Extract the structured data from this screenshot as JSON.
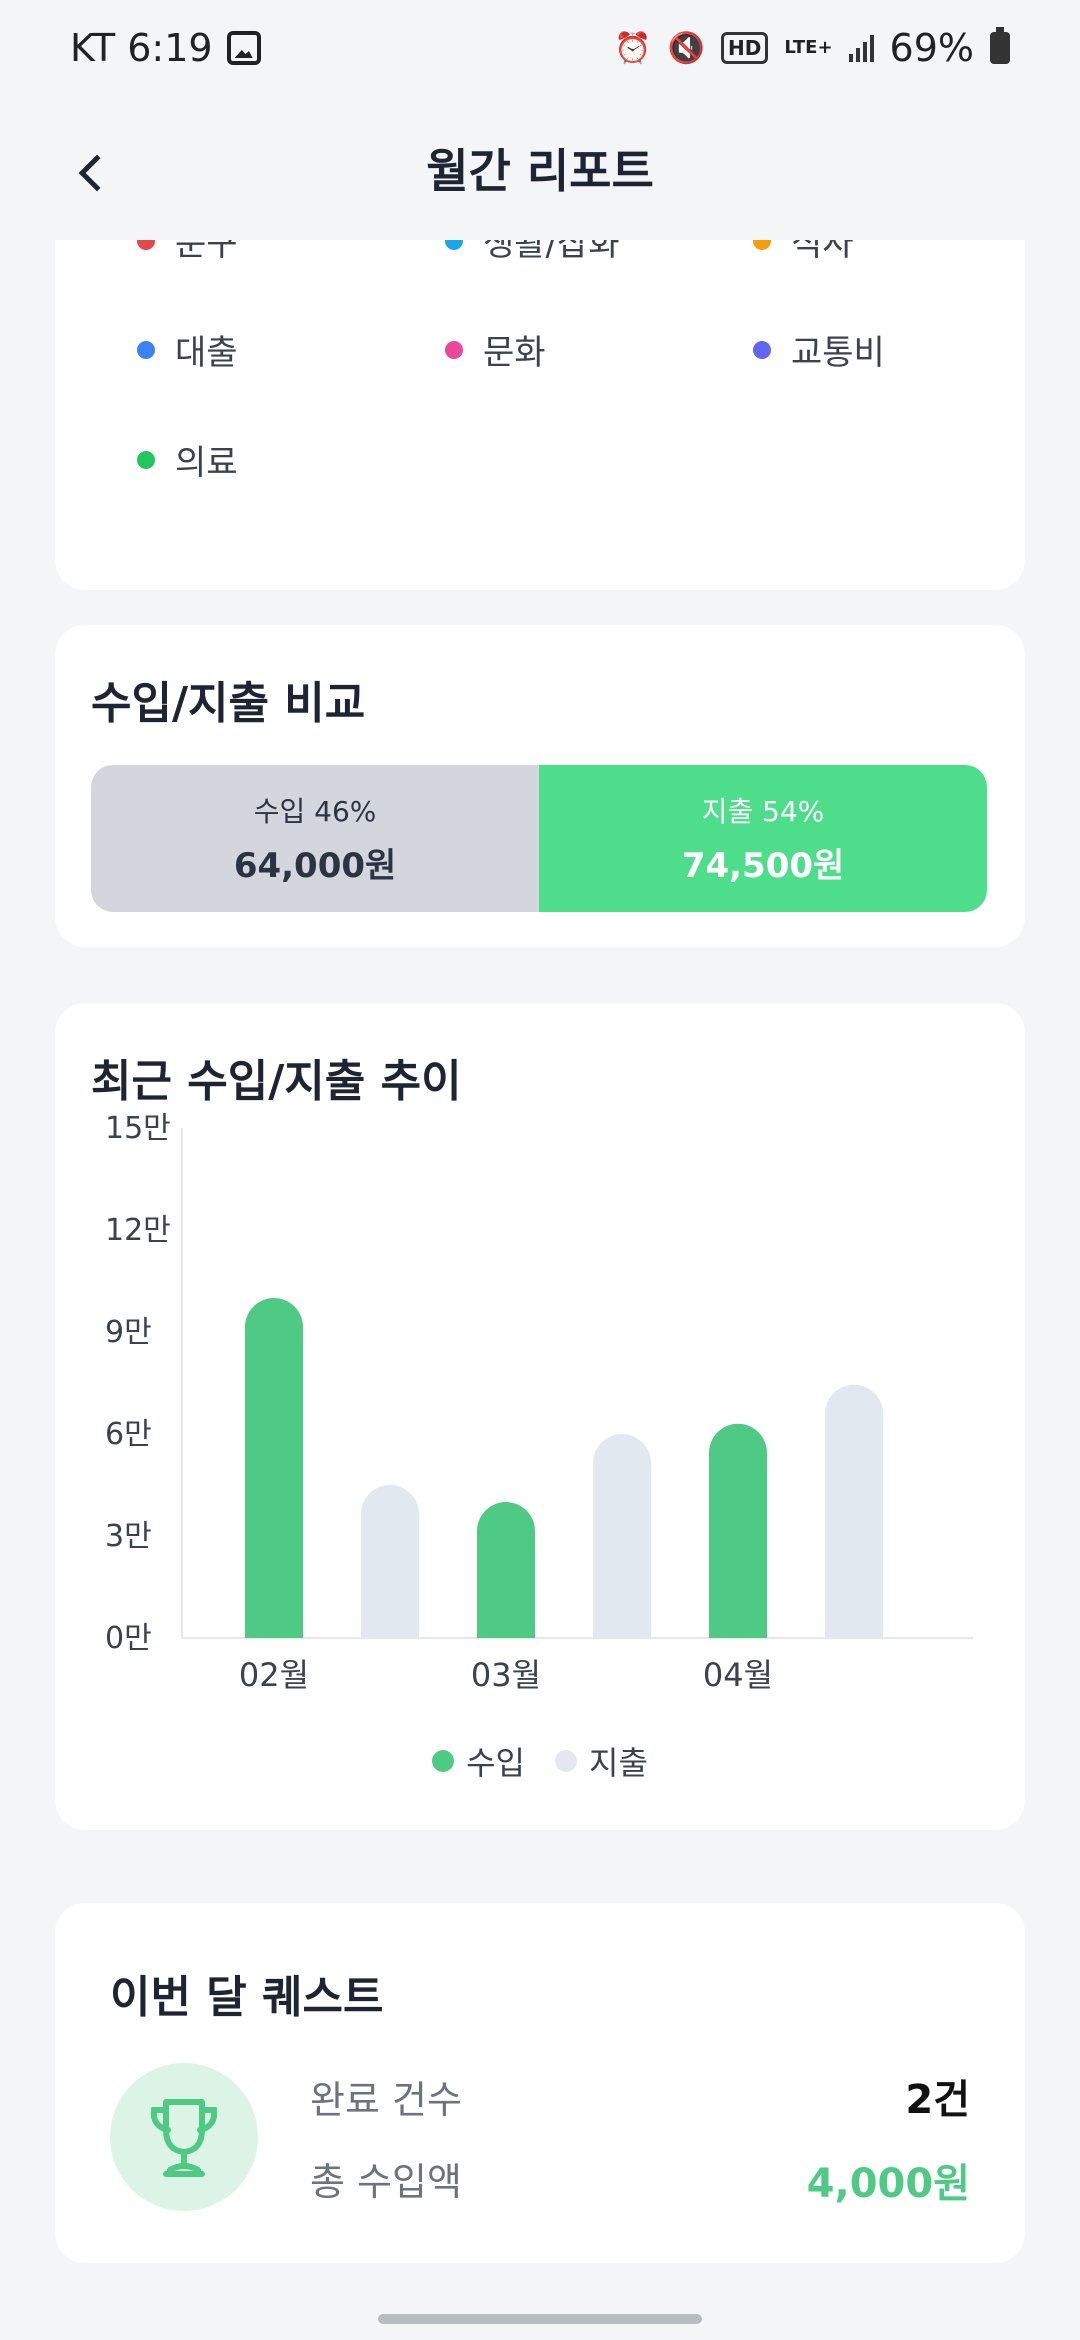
{
  "status_bar": {
    "carrier_time": "KT 6:19",
    "battery": "69%",
    "hd": "HD",
    "lte": "LTE+"
  },
  "header": {
    "title": "월간 리포트"
  },
  "category_legend": {
    "items": [
      {
        "label": "문구",
        "color": "#e54848"
      },
      {
        "label": "생활/잡화",
        "color": "#1aa7e8"
      },
      {
        "label": "식사",
        "color": "#f59e0b"
      },
      {
        "label": "대출",
        "color": "#3b82f6"
      },
      {
        "label": "문화",
        "color": "#ec4899"
      },
      {
        "label": "교통비",
        "color": "#6366f1"
      },
      {
        "label": "의료",
        "color": "#22c55e"
      }
    ]
  },
  "compare": {
    "title": "수입/지출 비교",
    "income_label": "수입 46%",
    "income_amount": "64,000원",
    "expense_label": "지출 54%",
    "expense_amount": "74,500원",
    "income_share": 0.46
  },
  "trend": {
    "title": "최근 수입/지출 추이",
    "legend_income": "수입",
    "legend_expense": "지출"
  },
  "chart_data": {
    "type": "bar",
    "title": "최근 수입/지출 추이",
    "categories": [
      "02월",
      "03월",
      "04월"
    ],
    "series": [
      {
        "name": "수입",
        "values": [
          100000,
          40000,
          63000
        ],
        "color": "#4fca84"
      },
      {
        "name": "지출",
        "values": [
          45000,
          60000,
          74500
        ],
        "color": "#e2e8f0"
      }
    ],
    "y_ticks": [
      "0만",
      "3만",
      "6만",
      "9만",
      "12만",
      "15만"
    ],
    "ylim": [
      0,
      150000
    ],
    "grid": false,
    "legend_position": "bottom"
  },
  "quest": {
    "title": "이번 달 퀘스트",
    "completed_label": "완료 건수",
    "completed_value": "2건",
    "income_label": "총 수입액",
    "income_value": "4,000원",
    "accent": "#4fca84"
  }
}
